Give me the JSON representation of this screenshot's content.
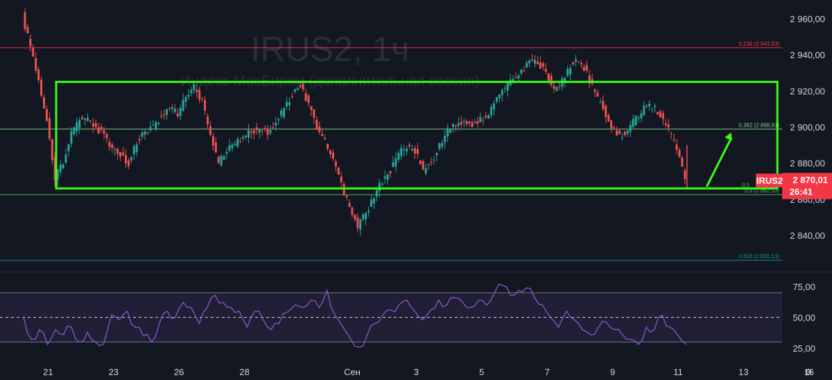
{
  "chart_data": [
    {
      "type": "candlestick",
      "title": "IRUS2, 1ч",
      "subtitle": "Индекс МосБиржи (дополнительная сессия)",
      "ylim": [
        2820,
        2970
      ],
      "y_ticks": [
        2840,
        2860,
        2880,
        2900,
        2920,
        2940,
        2960
      ],
      "y_tick_labels": [
        "2 840,00",
        "2 860,00",
        "2 880,00",
        "2 900,00",
        "2 920,00",
        "2 940,00",
        "2 960,00"
      ],
      "x_ticks": [
        {
          "label": "21",
          "index": 3
        },
        {
          "label": "23",
          "index": 11
        },
        {
          "label": "26",
          "index": 19
        },
        {
          "label": "28",
          "index": 27
        },
        {
          "label": "Сен",
          "index": 40
        },
        {
          "label": "3",
          "index": 48
        },
        {
          "label": "5",
          "index": 56
        },
        {
          "label": "7",
          "index": 64
        },
        {
          "label": "9",
          "index": 72
        },
        {
          "label": "11",
          "index": 80
        },
        {
          "label": "13",
          "index": 88
        },
        {
          "label": "16",
          "index": 96
        }
      ],
      "colors": {
        "up": "#26a69a",
        "down": "#ef5350",
        "box": "#39ff14",
        "background": "#131722"
      },
      "close_path": [
        2962,
        2944,
        2925,
        2905,
        2872,
        2880,
        2896,
        2904,
        2905,
        2900,
        2895,
        2888,
        2885,
        2880,
        2892,
        2898,
        2900,
        2906,
        2910,
        2908,
        2916,
        2922,
        2914,
        2895,
        2880,
        2888,
        2890,
        2895,
        2898,
        2899,
        2897,
        2902,
        2910,
        2918,
        2924,
        2912,
        2900,
        2892,
        2882,
        2868,
        2855,
        2845,
        2852,
        2862,
        2870,
        2876,
        2885,
        2890,
        2887,
        2876,
        2880,
        2890,
        2898,
        2902,
        2904,
        2902,
        2904,
        2908,
        2915,
        2922,
        2926,
        2930,
        2937,
        2936,
        2930,
        2922,
        2925,
        2934,
        2937,
        2930,
        2918,
        2910,
        2900,
        2895,
        2898,
        2905,
        2910,
        2912,
        2906,
        2898,
        2888,
        2870
      ],
      "fib_levels": [
        {
          "label": "0,236 (2 943,93)",
          "value": 2943.93,
          "color": "#f23645"
        },
        {
          "label": "0,382 (2 898,91)",
          "value": 2898.91,
          "color": "#81c784"
        },
        {
          "label": "0,5 (2 862,53)",
          "value": 2862.53,
          "color": "#4caf50"
        },
        {
          "label": "0,618 (2 826,13)",
          "value": 2826.13,
          "color": "#089981"
        }
      ],
      "fib_level_cut": {
        "label": "0,5",
        "value": 2866.5,
        "color": "#4caf50"
      },
      "annotation_box": {
        "x_start_index": 5,
        "x_end_index": 94,
        "y_low": 2866,
        "y_high": 2925
      },
      "annotation_arrow": {
        "from_index": 83.5,
        "from_value": 2867,
        "to_index": 86.5,
        "to_value": 2897
      },
      "last_price": {
        "symbol": "IRUS2",
        "price": "2 870,01",
        "countdown": "26:41",
        "value": 2870.01
      },
      "hidden_tick_label": "2 860,00"
    },
    {
      "type": "line",
      "name": "RSI",
      "ylim": [
        18,
        82
      ],
      "y_ticks": [
        25,
        50,
        75
      ],
      "y_tick_labels": [
        "25,00",
        "50,00",
        "75,00"
      ],
      "band": [
        30,
        70
      ],
      "midline": 50,
      "colors": {
        "line": "#7e57c2",
        "band": "#7e57c2"
      },
      "values": [
        50,
        32,
        40,
        28,
        40,
        36,
        42,
        30,
        38,
        30,
        28,
        52,
        48,
        55,
        42,
        35,
        30,
        45,
        55,
        50,
        62,
        58,
        45,
        58,
        68,
        62,
        58,
        55,
        42,
        55,
        48,
        40,
        45,
        54,
        60,
        58,
        64,
        58,
        72,
        52,
        42,
        32,
        26,
        35,
        45,
        52,
        56,
        60,
        64,
        55,
        48,
        56,
        64,
        60,
        66,
        62,
        58,
        64,
        60,
        70,
        76,
        68,
        72,
        74,
        66,
        60,
        50,
        42,
        55,
        48,
        40,
        36,
        42,
        46,
        40,
        36,
        32,
        28,
        42,
        40,
        52,
        42,
        35,
        28
      ]
    }
  ]
}
